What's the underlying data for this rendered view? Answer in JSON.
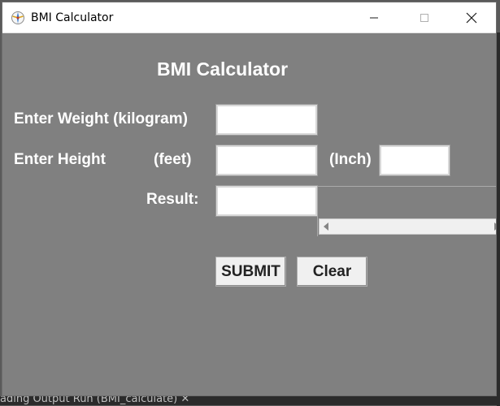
{
  "window": {
    "title": "BMI Calculator"
  },
  "form": {
    "heading": "BMI Calculator",
    "weight_label": "Enter Weight (kilogram)",
    "height_label": "Enter Height",
    "feet_label": "(feet)",
    "inch_label": "(Inch)",
    "result_label": "Result:",
    "weight_value": "",
    "feet_value": "",
    "inch_value": "",
    "result_value": ""
  },
  "buttons": {
    "submit_label": "SUBMIT",
    "clear_label": "Clear"
  },
  "background_ide": {
    "bottom_text": "ading     Output    Run (BMI_calculate)    ✕"
  },
  "colors": {
    "window_bg": "#808080",
    "titlebar_bg": "#ffffff",
    "label_text": "#ffffff",
    "button_bg": "#f0f0f0"
  },
  "icons": {
    "app": "feather-tk-icon",
    "minimize": "minimize-icon",
    "maximize": "maximize-icon",
    "close": "close-icon"
  }
}
